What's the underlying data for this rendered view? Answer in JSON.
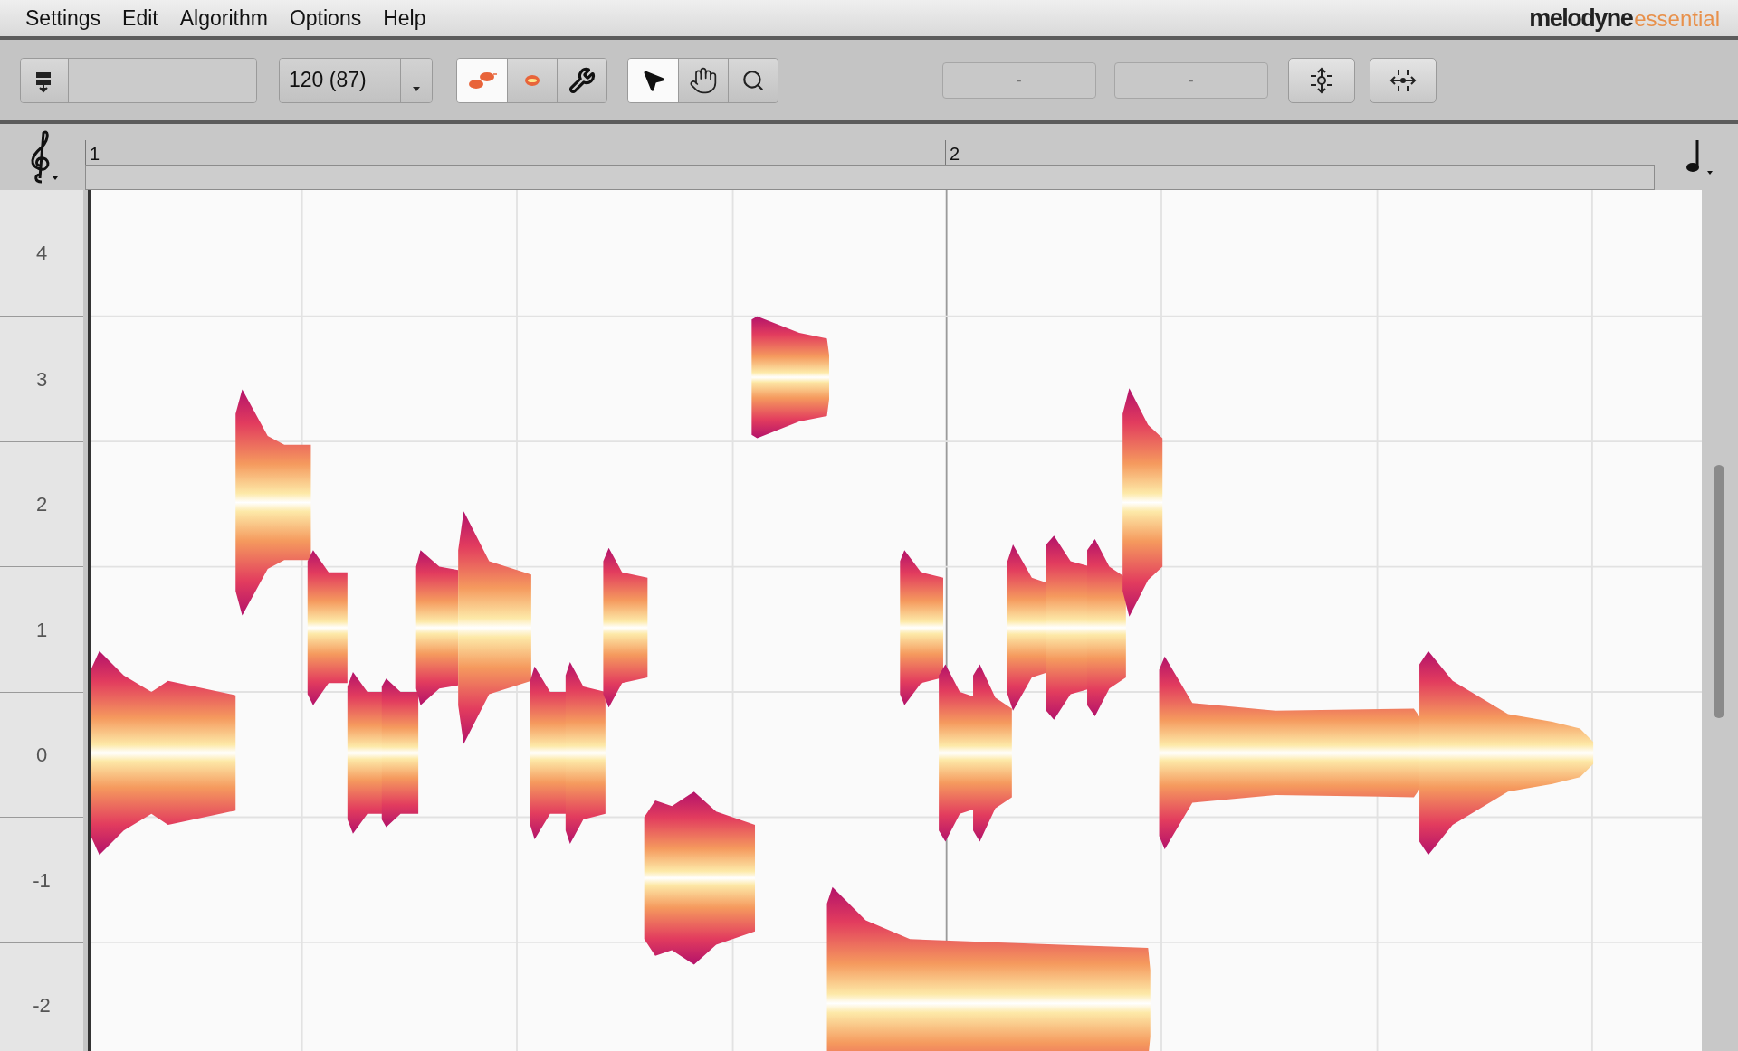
{
  "menu": [
    "Settings",
    "Edit",
    "Algorithm",
    "Options",
    "Help"
  ],
  "logo": {
    "brand": "melodyne",
    "edition": "essential"
  },
  "toolbar": {
    "tempo": "120 (87)",
    "note_tools": [
      {
        "kind": "pitch",
        "selected": true
      },
      {
        "kind": "amplitude",
        "selected": false
      },
      {
        "kind": "wrench",
        "selected": false
      }
    ],
    "main_tools": [
      {
        "kind": "pointer",
        "selected": true
      },
      {
        "kind": "hand",
        "selected": false
      },
      {
        "kind": "zoom",
        "selected": false
      }
    ],
    "fields": [
      "-",
      "-"
    ]
  },
  "ruler": {
    "bars": [
      "1",
      "2"
    ]
  },
  "pitch_axis": [
    "4",
    "3",
    "2",
    "1",
    "0",
    "-1",
    "-2"
  ]
}
